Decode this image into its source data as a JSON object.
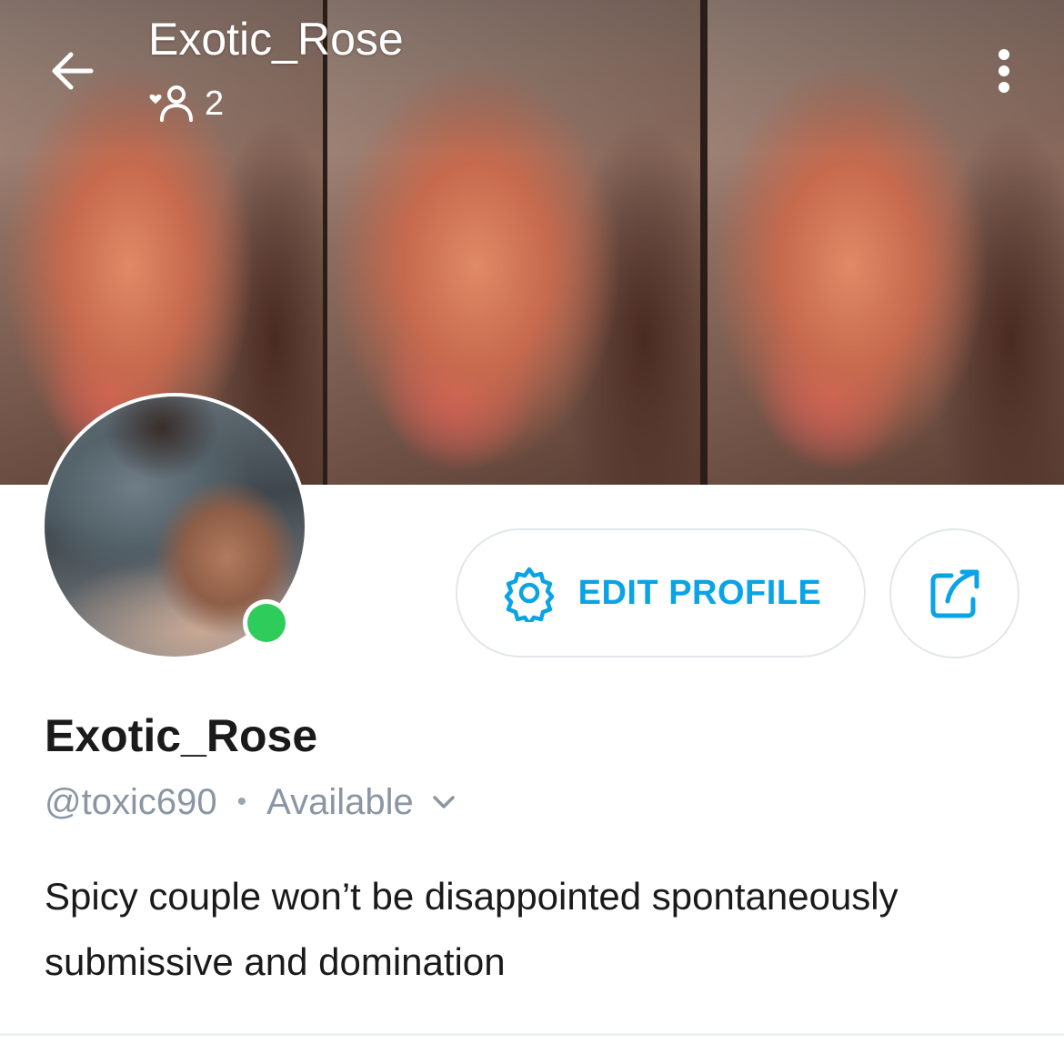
{
  "header": {
    "title": "Exotic_Rose",
    "fans_count": "2",
    "back_icon": "arrow-left-icon",
    "fans_icon": "heart-person-icon",
    "more_icon": "vertical-dots-icon"
  },
  "profile": {
    "display_name": "Exotic_Rose",
    "username": "@toxic690",
    "separator": "•",
    "status": "Available",
    "status_icon": "chevron-down-icon",
    "online": true,
    "bio": "Spicy couple won’t be disappointed spontaneously submissive and domination"
  },
  "actions": {
    "edit_profile_label": "EDIT PROFILE",
    "edit_icon": "gear-icon",
    "share_icon": "share-icon"
  },
  "colors": {
    "accent": "#0aa3e6",
    "online": "#2ecc5a",
    "muted_text": "#8a96a3",
    "text": "#1a1a1a"
  }
}
